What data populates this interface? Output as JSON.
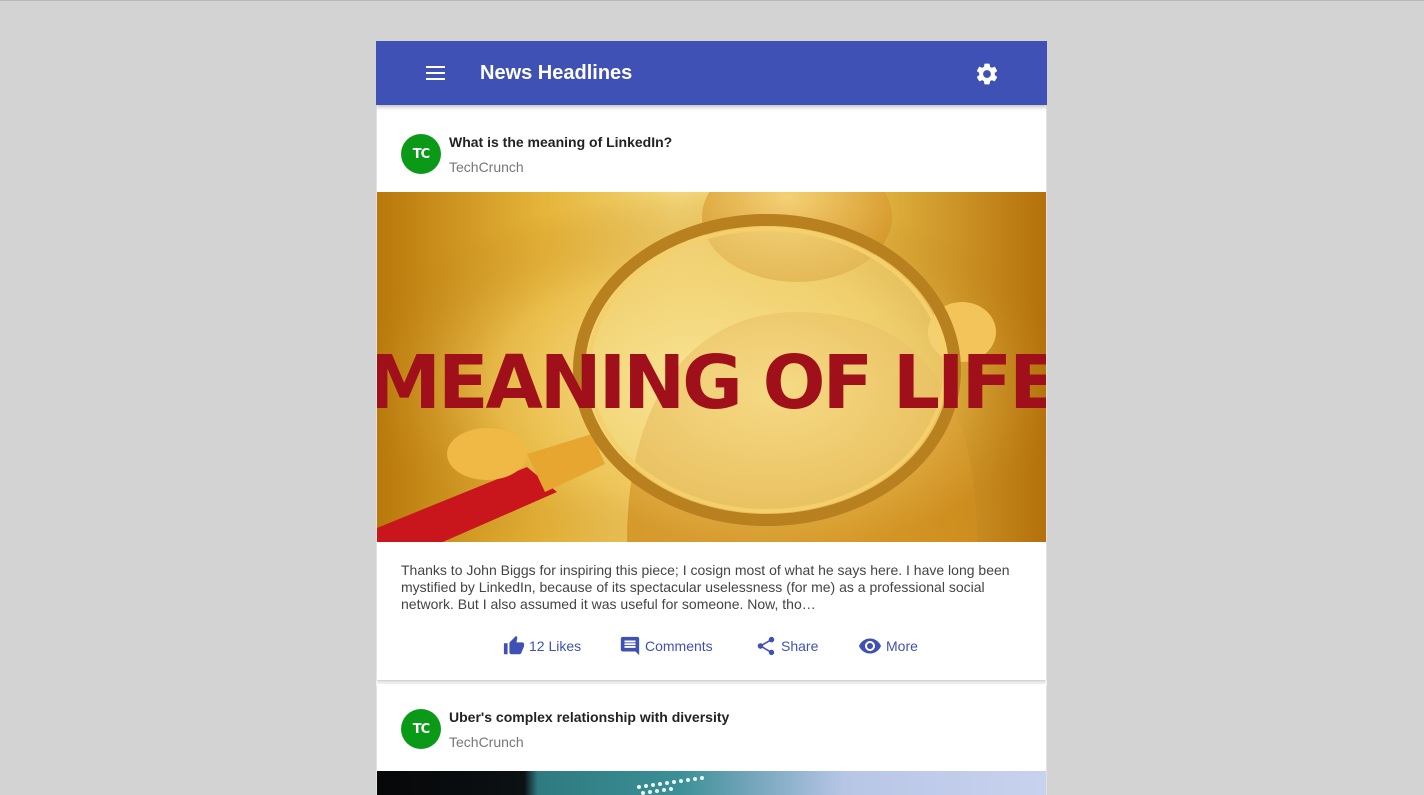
{
  "appbar": {
    "title": "News Headlines",
    "menu_icon": "menu-icon",
    "settings_icon": "gear-icon",
    "color": "#3f51b5"
  },
  "cards": [
    {
      "title": "What is the meaning of LinkedIn?",
      "source": "TechCrunch",
      "avatar_text": "TC",
      "image_text": "MEANING OF LIFE",
      "body": "Thanks to John Biggs for inspiring this piece; I cosign most of what he says here. I have long been mystified by LinkedIn, because of its spectacular uselessness (for me) as a professional social network. But I also assumed it was useful for someone. Now, tho…",
      "actions": {
        "likes": "12 Likes",
        "comments": "Comments",
        "share": "Share",
        "more": "More"
      }
    },
    {
      "title": "Uber's complex relationship with diversity",
      "source": "TechCrunch",
      "avatar_text": "TC"
    }
  ],
  "colors": {
    "accent": "#3f51b5",
    "avatar_bg": "#0a9a18",
    "page_bg": "#d3d3d3"
  }
}
